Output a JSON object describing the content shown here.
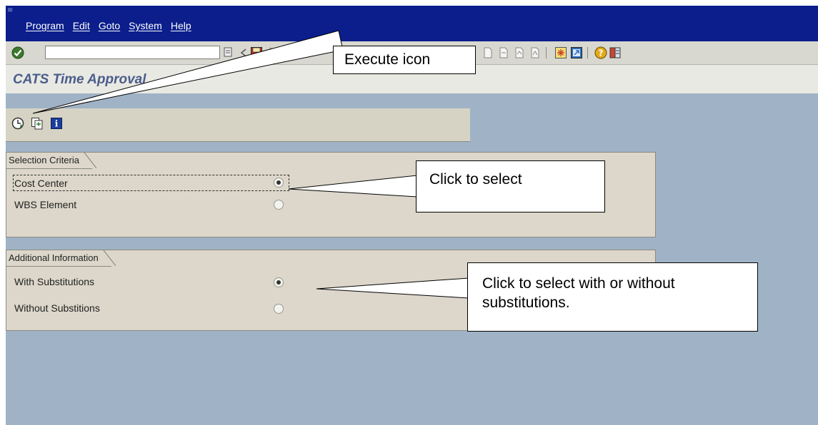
{
  "menu": {
    "items": [
      "Program",
      "Edit",
      "Goto",
      "System",
      "Help"
    ]
  },
  "toolbar": {
    "command_field_value": "",
    "icons": [
      "enter-check-icon",
      "command-dropdown-icon",
      "back-arrow-icon",
      "save-icon",
      "back-icon",
      "exit-icon",
      "print-icon",
      "find-icon",
      "find-next-icon",
      "first-page-icon",
      "previous-page-icon",
      "next-page-icon",
      "last-page-icon",
      "create-session-icon",
      "shortcut-icon",
      "help-icon",
      "layout-menu-icon"
    ]
  },
  "page": {
    "title": "CATS Time Approval"
  },
  "app_toolbar": {
    "icons": [
      "execute-icon",
      "variant-icon",
      "info-icon"
    ]
  },
  "selection_criteria": {
    "title": "Selection Criteria",
    "options": [
      {
        "label": "Cost Center",
        "selected": true
      },
      {
        "label": "WBS Element",
        "selected": false
      }
    ]
  },
  "additional_information": {
    "title": "Additional Information",
    "options": [
      {
        "label": "With Substitutions",
        "selected": true
      },
      {
        "label": "Without Substitions",
        "selected": false
      }
    ]
  },
  "callouts": {
    "execute": "Execute icon",
    "select": "Click to select",
    "substitutions": "Click to select with or without substitutions."
  },
  "colors": {
    "menu_bar": "#0b1e8c",
    "workspace": "#a0b3c6",
    "title_text": "#4b5d8c",
    "group_bg": "#dcd7ca"
  }
}
